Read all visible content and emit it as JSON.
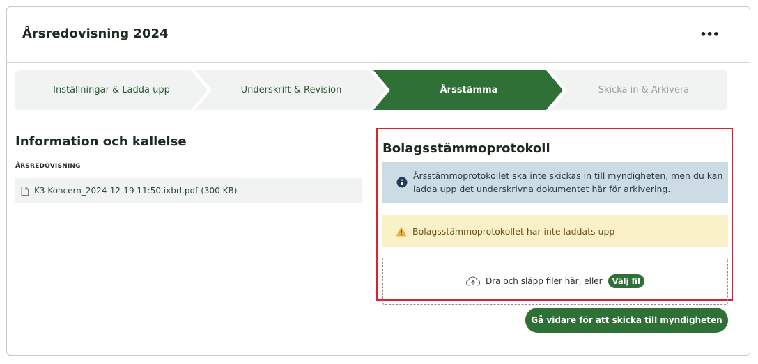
{
  "header": {
    "title": "Årsredovisning 2024",
    "more_label": "•••"
  },
  "stepper": {
    "steps": [
      {
        "label": "Inställningar & Ladda upp",
        "state": "done"
      },
      {
        "label": "Underskrift & Revision",
        "state": "done"
      },
      {
        "label": "Årsstämma",
        "state": "active"
      },
      {
        "label": "Skicka in & Arkivera",
        "state": "upcoming"
      }
    ],
    "colors": {
      "done_bg": "#f1f3f2",
      "done_text": "#2e5a34",
      "active_bg": "#2e7035",
      "active_text": "#ffffff",
      "upcoming_text": "#9aa09c"
    }
  },
  "left": {
    "heading": "Information och kallelse",
    "group_label": "ÅRSREDOVISNING",
    "files": [
      {
        "name": "K3 Koncern_2024-12-19 11:50.ixbrl.pdf (300 KB)",
        "icon": "file-icon"
      }
    ]
  },
  "panel": {
    "heading": "Bolagsstämmoprotokoll",
    "info_text": "Årsstämmoprotokollet ska inte skickas in till myndigheten, men du kan ladda upp det underskrivna dokumentet här för arkivering.",
    "warning_text": "Bolagsstämmoprotokollet har inte laddats upp",
    "drop_text": "Dra och släpp filer här, eller",
    "choose_file": "Välj fil",
    "highlight_color": "#d9242e"
  },
  "actions": {
    "primary": "Gå vidare för att skicka till myndigheten",
    "color": "#2e7035"
  }
}
